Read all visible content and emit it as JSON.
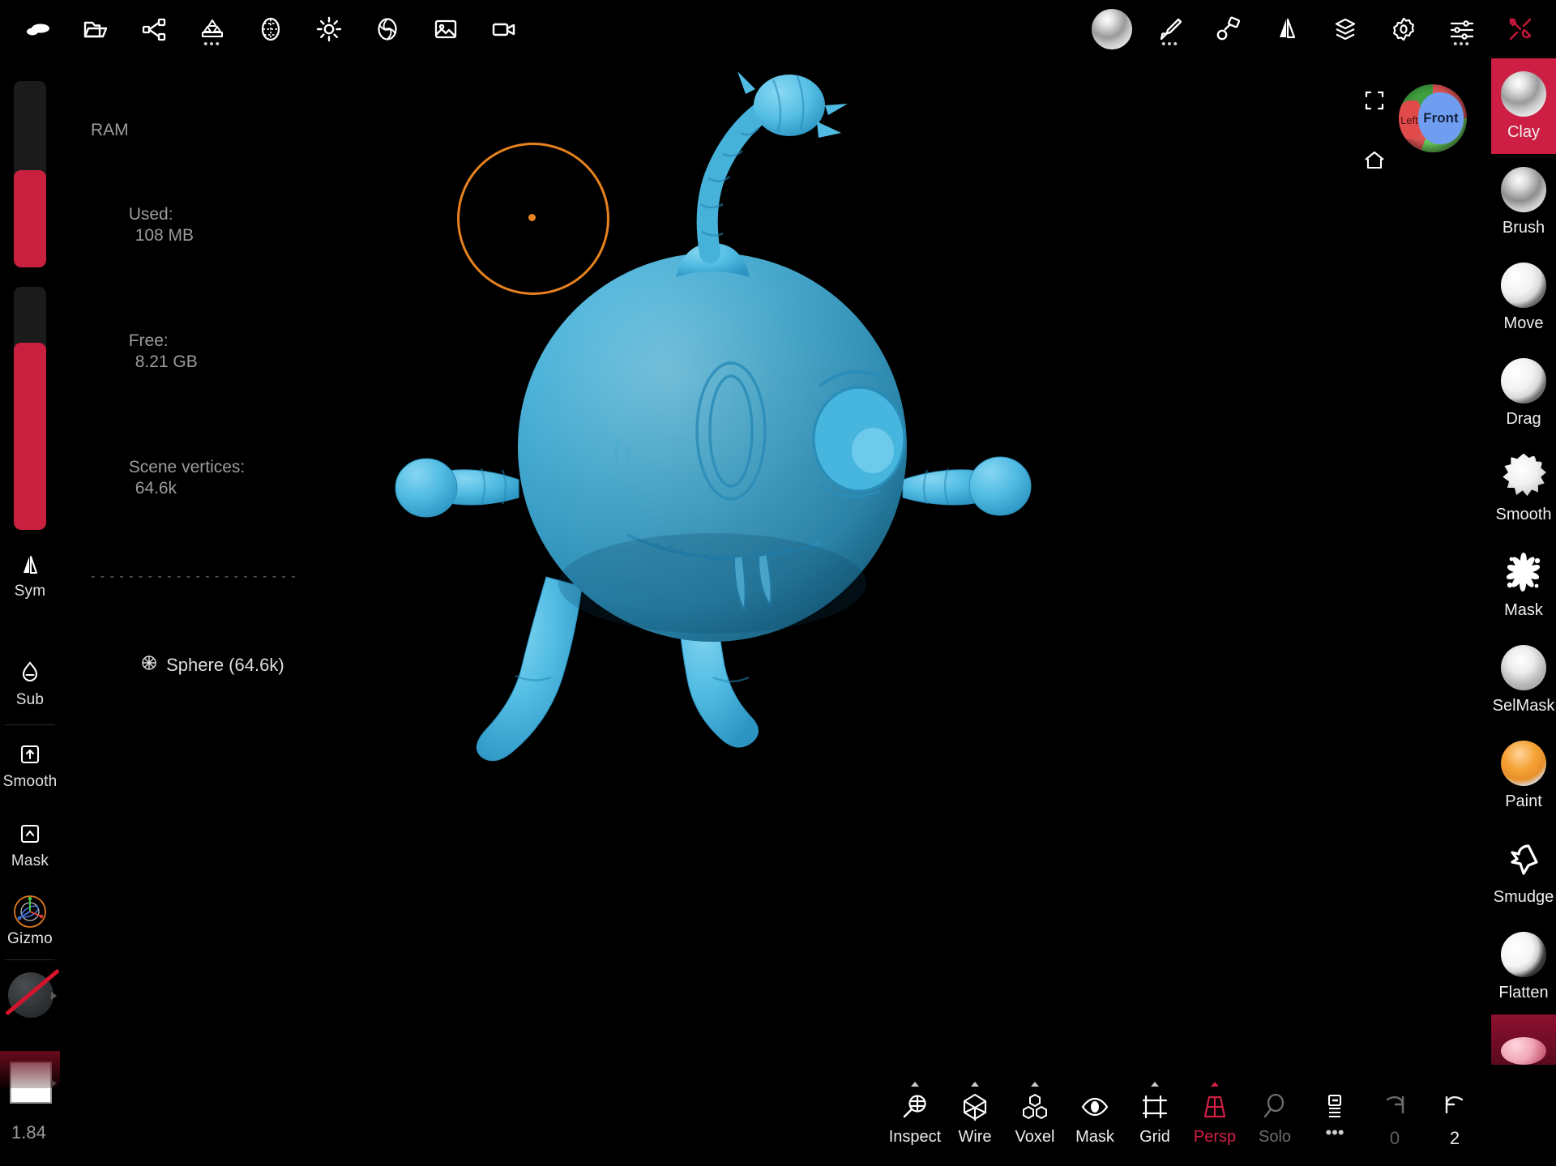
{
  "app": {
    "accent_red": "#cc1f43",
    "slider_red": "#c9203f",
    "cursor_orange": "#e8821e",
    "model_blue": "#45b5de",
    "background": "#000000"
  },
  "topbar": {
    "left_tools": [
      {
        "name": "nomad-logo-icon",
        "label": "Nomad"
      },
      {
        "name": "folder-open-icon",
        "label": "Files"
      },
      {
        "name": "share-nodes-icon",
        "label": "Share"
      },
      {
        "name": "primitives-icon",
        "label": "Primitives",
        "has_overflow": true
      },
      {
        "name": "matcap-sphere-icon",
        "label": "Matcap"
      },
      {
        "name": "lighting-icon",
        "label": "Lighting"
      },
      {
        "name": "post-process-icon",
        "label": "Post Process"
      },
      {
        "name": "background-image-icon",
        "label": "Background"
      },
      {
        "name": "camera-icon",
        "label": "Camera"
      }
    ],
    "right_tools": [
      {
        "name": "material-sphere-icon",
        "label": "Material",
        "active": true
      },
      {
        "name": "brush-icon",
        "label": "Brush",
        "has_overflow": true
      },
      {
        "name": "paint-roller-icon",
        "label": "Stroke"
      },
      {
        "name": "symmetry-mirror-icon",
        "label": "Symmetry"
      },
      {
        "name": "layers-icon",
        "label": "Layers"
      },
      {
        "name": "gear-icon",
        "label": "Settings"
      },
      {
        "name": "sliders-icon",
        "label": "Sliders",
        "has_overflow": true
      },
      {
        "name": "tools-wrench-icon",
        "label": "Tools",
        "highlight": true
      }
    ]
  },
  "left_sidebar": {
    "sliders": [
      {
        "name": "brush-radius-slider",
        "label": "Radius",
        "fill_percent": 52
      },
      {
        "name": "brush-intensity-slider",
        "label": "Intensity",
        "fill_percent": 77
      }
    ],
    "items": [
      {
        "name": "sym-button",
        "label": "Sym",
        "icon": "symmetry-mirror-icon"
      },
      {
        "name": "sub-button",
        "label": "Sub",
        "icon": "drop-minus-icon"
      },
      {
        "name": "smooth-button",
        "label": "Smooth",
        "icon": "key-up-arrow-icon"
      },
      {
        "name": "mask-button",
        "label": "Mask",
        "icon": "key-caret-icon"
      },
      {
        "name": "gizmo-button",
        "label": "Gizmo",
        "icon": "axis-gizmo-icon"
      }
    ],
    "swatches": [
      {
        "name": "material-swatch",
        "label": "Material (off)",
        "value": "none"
      },
      {
        "name": "color-swatch",
        "label": "Color",
        "value": "#ffffff"
      }
    ],
    "brush_value": "1.84"
  },
  "viewport": {
    "stats": {
      "ram_title": "RAM",
      "used_label": "Used:",
      "used_value": "108 MB",
      "free_label": "Free:",
      "free_value": "8.21 GB",
      "vertices_label": "Scene vertices:",
      "vertices_value": "64.6k",
      "divider": "- - - - - - - - - - - - - - - - - - - - - -",
      "object_name": "Sphere (64.6k)"
    },
    "controls": [
      {
        "name": "fullscreen-icon",
        "label": "Fullscreen"
      },
      {
        "name": "home-view-icon",
        "label": "Home View"
      }
    ],
    "nav_gizmo": {
      "name": "view-orientation-gizmo",
      "front_label": "Front",
      "left_label": "Left"
    },
    "brush_cursor": {
      "name": "brush-cursor",
      "radius_px": 94
    },
    "model": {
      "name": "sculpted-creature-model",
      "color": "#45b5de"
    }
  },
  "right_sidebar": {
    "brushes": [
      {
        "name": "brush-clay",
        "label": "Clay",
        "active": true
      },
      {
        "name": "brush-brush",
        "label": "Brush",
        "active": false
      },
      {
        "name": "brush-move",
        "label": "Move",
        "active": false
      },
      {
        "name": "brush-drag",
        "label": "Drag",
        "active": false
      },
      {
        "name": "brush-smooth",
        "label": "Smooth",
        "active": false
      },
      {
        "name": "brush-mask",
        "label": "Mask",
        "active": false
      },
      {
        "name": "brush-selmask",
        "label": "SelMask",
        "active": false
      },
      {
        "name": "brush-paint",
        "label": "Paint",
        "active": false
      },
      {
        "name": "brush-smudge",
        "label": "Smudge",
        "active": false
      },
      {
        "name": "brush-flatten",
        "label": "Flatten",
        "active": false
      }
    ]
  },
  "bottom_bar": {
    "items": [
      {
        "name": "bottom-inspect",
        "label": "Inspect",
        "icon": "inspect-icon",
        "state": "normal",
        "caret": true
      },
      {
        "name": "bottom-wire",
        "label": "Wire",
        "icon": "wireframe-icon",
        "state": "normal",
        "caret": true
      },
      {
        "name": "bottom-voxel",
        "label": "Voxel",
        "icon": "voxel-icon",
        "state": "normal",
        "caret": true
      },
      {
        "name": "bottom-mask",
        "label": "Mask",
        "icon": "eye-mask-icon",
        "state": "normal",
        "caret": false
      },
      {
        "name": "bottom-grid",
        "label": "Grid",
        "icon": "grid-icon",
        "state": "normal",
        "caret": true
      },
      {
        "name": "bottom-persp",
        "label": "Persp",
        "icon": "perspective-icon",
        "state": "active",
        "caret": true
      },
      {
        "name": "bottom-solo",
        "label": "Solo",
        "icon": "solo-magnifier-icon",
        "state": "disabled",
        "caret": false
      }
    ],
    "overflow": {
      "name": "bottom-more",
      "icon": "history-list-icon",
      "dots": "•••"
    },
    "redo": {
      "name": "redo-button",
      "icon": "redo-arrow-icon",
      "count": "0",
      "state": "disabled"
    },
    "undo": {
      "name": "undo-button",
      "icon": "undo-arrow-icon",
      "count": "2",
      "state": "normal"
    }
  }
}
